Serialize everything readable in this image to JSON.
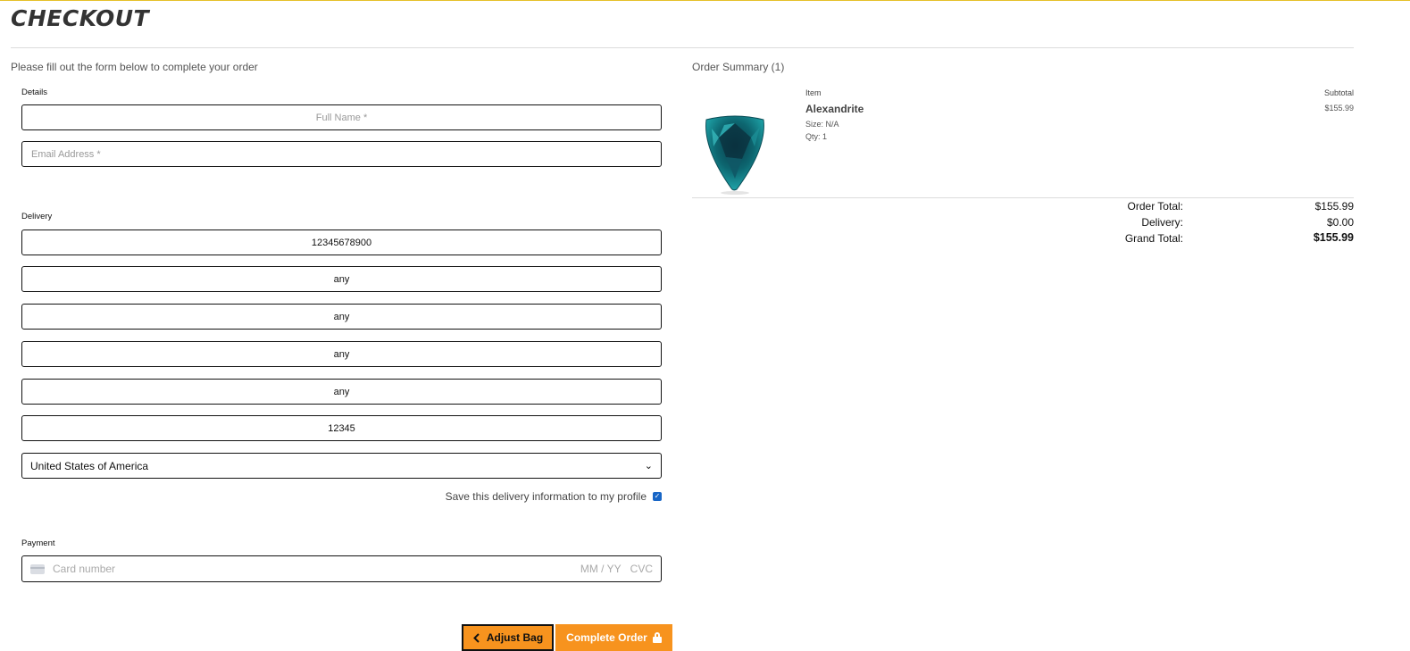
{
  "page": {
    "title": "CHECKOUT",
    "intro": "Please fill out the form below to complete your order"
  },
  "details": {
    "label": "Details",
    "full_name_placeholder": "Full Name *",
    "email_placeholder": "Email Address *"
  },
  "delivery": {
    "label": "Delivery",
    "phone": "12345678900",
    "street1": "any",
    "street2": "any",
    "town": "any",
    "county": "any",
    "postcode": "12345",
    "country": "United States of America",
    "save_label": "Save this delivery information to my profile",
    "save_checked": true
  },
  "payment": {
    "label": "Payment",
    "card_placeholder": "Card number",
    "expiry_placeholder": "MM / YY",
    "cvc_placeholder": "CVC"
  },
  "buttons": {
    "adjust_bag": "Adjust Bag",
    "complete_order": "Complete Order"
  },
  "summary": {
    "title": "Order Summary (1)",
    "col_item": "Item",
    "col_subtotal": "Subtotal",
    "product": {
      "name": "Alexandrite",
      "size": "Size: N/A",
      "qty": "Qty: 1",
      "subtotal": "$155.99",
      "image": "teal-trillion-gem"
    },
    "order_total_label": "Order Total:",
    "order_total": "$155.99",
    "delivery_label": "Delivery:",
    "delivery_cost": "$0.00",
    "grand_total_label": "Grand Total:",
    "grand_total": "$155.99"
  },
  "colors": {
    "accent_orange": "#f7931e",
    "top_rule": "#e6c029",
    "checkbox": "#1866c6"
  },
  "icons": [
    "chevron-left-icon",
    "lock-icon",
    "chevron-down-icon",
    "credit-card-icon",
    "checkbox-checked-icon"
  ]
}
